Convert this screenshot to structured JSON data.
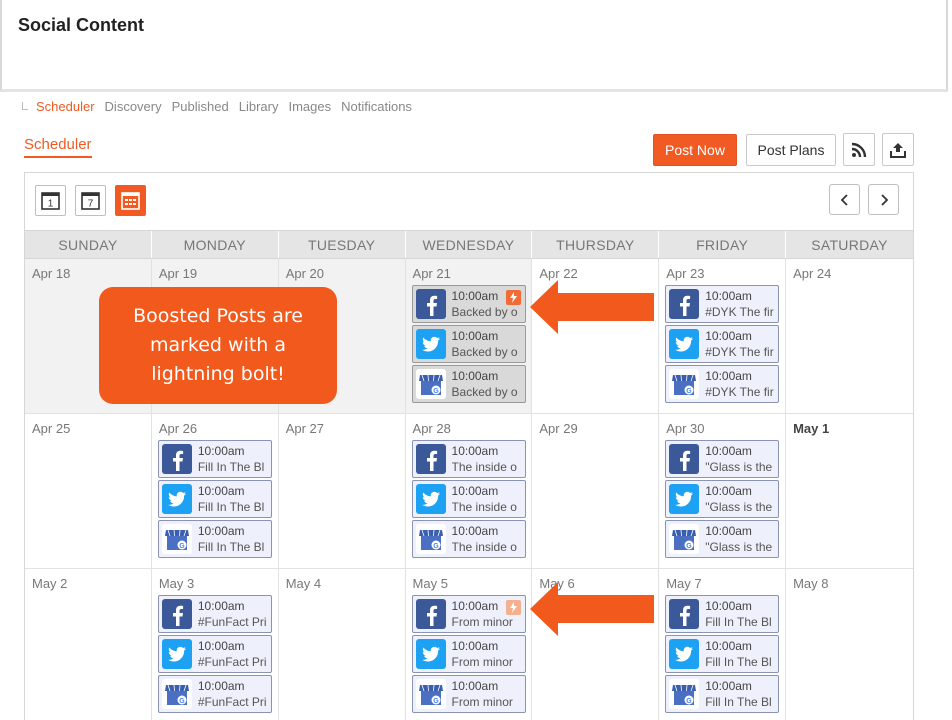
{
  "app": {
    "title": "Social Content"
  },
  "subnav": {
    "items": [
      {
        "label": "Scheduler",
        "active": true
      },
      {
        "label": "Discovery",
        "active": false
      },
      {
        "label": "Published",
        "active": false
      },
      {
        "label": "Library",
        "active": false
      },
      {
        "label": "Images",
        "active": false
      },
      {
        "label": "Notifications",
        "active": false
      }
    ]
  },
  "section": {
    "tab_label": "Scheduler"
  },
  "toolbar": {
    "post_now_label": "Post Now",
    "post_plans_label": "Post Plans",
    "rss_icon": "rss-icon",
    "export_icon": "upload-icon"
  },
  "calendar": {
    "view_buttons": [
      {
        "name": "day-view",
        "label": "1",
        "active": false
      },
      {
        "name": "week-view",
        "label": "7",
        "active": false
      },
      {
        "name": "month-view",
        "label": "",
        "active": true
      }
    ],
    "prev_icon": "chevron-left-icon",
    "next_icon": "chevron-right-icon",
    "weekdays": [
      "SUNDAY",
      "MONDAY",
      "TUESDAY",
      "WEDNESDAY",
      "THURSDAY",
      "FRIDAY",
      "SATURDAY"
    ],
    "weeks": [
      {
        "days": [
          {
            "label": "Apr 18",
            "past": true,
            "posts": []
          },
          {
            "label": "Apr 19",
            "past": true,
            "posts": []
          },
          {
            "label": "Apr 20",
            "past": true,
            "posts": []
          },
          {
            "label": "Apr 21",
            "past": true,
            "posts": [
              {
                "network": "facebook",
                "time": "10:00am",
                "text": "Backed by o",
                "boosted": true
              },
              {
                "network": "twitter",
                "time": "10:00am",
                "text": "Backed by o",
                "boosted": false
              },
              {
                "network": "google",
                "time": "10:00am",
                "text": "Backed by o",
                "boosted": false
              }
            ]
          },
          {
            "label": "Apr 22",
            "past": false,
            "posts": []
          },
          {
            "label": "Apr 23",
            "past": false,
            "posts": [
              {
                "network": "facebook",
                "time": "10:00am",
                "text": "#DYK The fir",
                "boosted": false
              },
              {
                "network": "twitter",
                "time": "10:00am",
                "text": "#DYK The fir",
                "boosted": false
              },
              {
                "network": "google",
                "time": "10:00am",
                "text": "#DYK The fir",
                "boosted": false
              }
            ]
          },
          {
            "label": "Apr 24",
            "past": false,
            "posts": []
          }
        ]
      },
      {
        "days": [
          {
            "label": "Apr 25",
            "past": false,
            "posts": []
          },
          {
            "label": "Apr 26",
            "past": false,
            "posts": [
              {
                "network": "facebook",
                "time": "10:00am",
                "text": "Fill In The Bl",
                "boosted": false
              },
              {
                "network": "twitter",
                "time": "10:00am",
                "text": "Fill In The Bl",
                "boosted": false
              },
              {
                "network": "google",
                "time": "10:00am",
                "text": "Fill In The Bl",
                "boosted": false
              }
            ]
          },
          {
            "label": "Apr 27",
            "past": false,
            "posts": []
          },
          {
            "label": "Apr 28",
            "past": false,
            "posts": [
              {
                "network": "facebook",
                "time": "10:00am",
                "text": "The inside o",
                "boosted": false
              },
              {
                "network": "twitter",
                "time": "10:00am",
                "text": "The inside o",
                "boosted": false
              },
              {
                "network": "google",
                "time": "10:00am",
                "text": "The inside o",
                "boosted": false
              }
            ]
          },
          {
            "label": "Apr 29",
            "past": false,
            "posts": []
          },
          {
            "label": "Apr 30",
            "past": false,
            "posts": [
              {
                "network": "facebook",
                "time": "10:00am",
                "text": "\"Glass is the",
                "boosted": false
              },
              {
                "network": "twitter",
                "time": "10:00am",
                "text": "\"Glass is the",
                "boosted": false
              },
              {
                "network": "google",
                "time": "10:00am",
                "text": "\"Glass is the",
                "boosted": false
              }
            ]
          },
          {
            "label": "May 1",
            "past": false,
            "bold": true,
            "posts": []
          }
        ]
      },
      {
        "days": [
          {
            "label": "May 2",
            "past": false,
            "posts": []
          },
          {
            "label": "May 3",
            "past": false,
            "posts": [
              {
                "network": "facebook",
                "time": "10:00am",
                "text": "#FunFact Pri",
                "boosted": false
              },
              {
                "network": "twitter",
                "time": "10:00am",
                "text": "#FunFact Pri",
                "boosted": false
              },
              {
                "network": "google",
                "time": "10:00am",
                "text": "#FunFact Pri",
                "boosted": false
              }
            ]
          },
          {
            "label": "May 4",
            "past": false,
            "posts": []
          },
          {
            "label": "May 5",
            "past": false,
            "posts": [
              {
                "network": "facebook",
                "time": "10:00am",
                "text": "From minor",
                "boosted": true,
                "bolt_faded": true
              },
              {
                "network": "twitter",
                "time": "10:00am",
                "text": "From minor",
                "boosted": false
              },
              {
                "network": "google",
                "time": "10:00am",
                "text": "From minor",
                "boosted": false
              }
            ]
          },
          {
            "label": "May 6",
            "past": false,
            "posts": []
          },
          {
            "label": "May 7",
            "past": false,
            "posts": [
              {
                "network": "facebook",
                "time": "10:00am",
                "text": "Fill In The Bl",
                "boosted": false
              },
              {
                "network": "twitter",
                "time": "10:00am",
                "text": "Fill In The Bl",
                "boosted": false
              },
              {
                "network": "google",
                "time": "10:00am",
                "text": "Fill In The Bl",
                "boosted": false
              }
            ]
          },
          {
            "label": "May 8",
            "past": false,
            "posts": []
          }
        ]
      }
    ]
  },
  "callout": {
    "text": "Boosted Posts are marked with a lightning bolt!",
    "color": "#f25a1d"
  },
  "colors": {
    "accent": "#f15a22",
    "facebook": "#3b5998",
    "twitter": "#1da1f2",
    "boost_bolt": "#f26b34"
  }
}
